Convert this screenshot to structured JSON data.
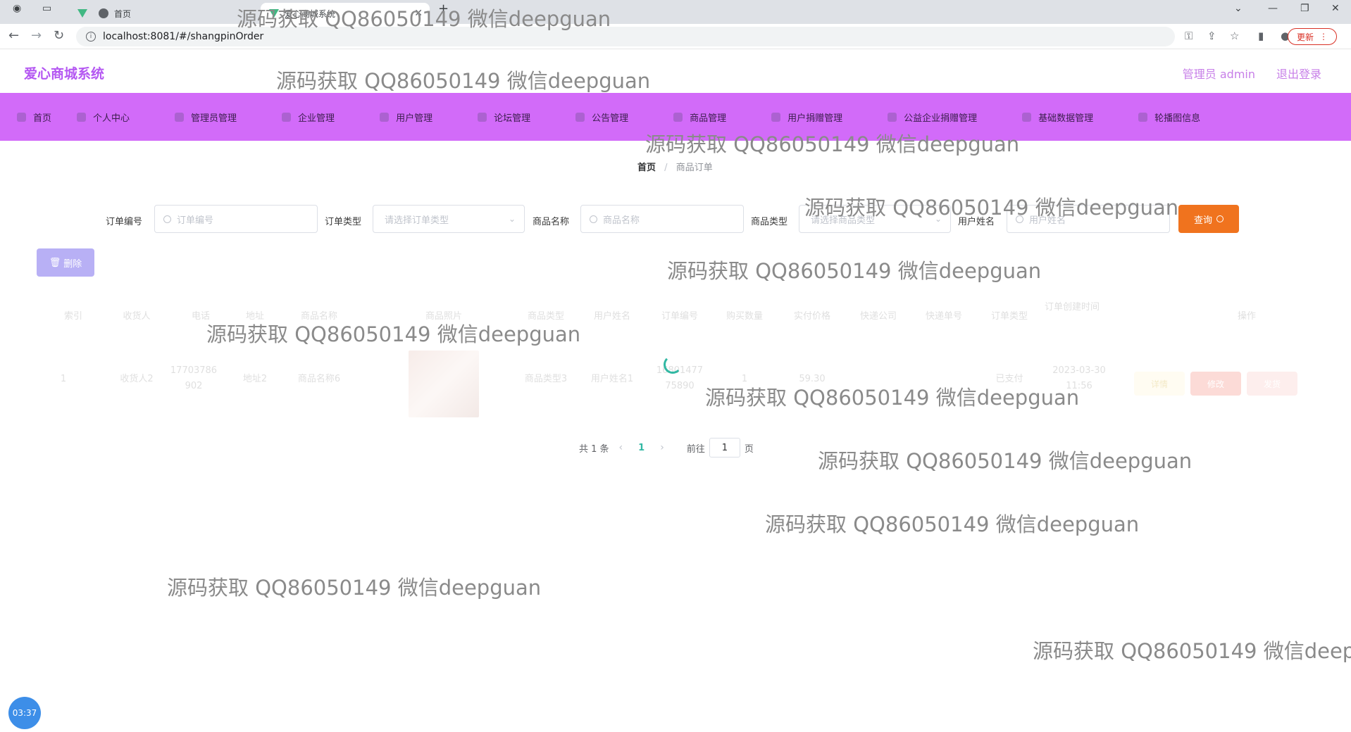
{
  "browser": {
    "tabs": [
      {
        "title": "首页"
      },
      {
        "title": "爱心商城系统"
      }
    ],
    "url": "localhost:8081/#/shangpinOrder",
    "update_label": "更新"
  },
  "header": {
    "app_title": "爱心商城系统",
    "admin_label": "管理员 admin",
    "logout_label": "退出登录"
  },
  "nav": [
    {
      "label": "首页"
    },
    {
      "label": "个人中心"
    },
    {
      "label": "管理员管理"
    },
    {
      "label": "企业管理"
    },
    {
      "label": "用户管理"
    },
    {
      "label": "论坛管理"
    },
    {
      "label": "公告管理"
    },
    {
      "label": "商品管理"
    },
    {
      "label": "用户捐赠管理"
    },
    {
      "label": "公益企业捐赠管理"
    },
    {
      "label": "基础数据管理"
    },
    {
      "label": "轮播图信息"
    }
  ],
  "breadcrumb": {
    "home": "首页",
    "sep": "/",
    "current": "商品订单"
  },
  "search": {
    "order_no": {
      "label": "订单编号",
      "placeholder": "订单编号"
    },
    "order_type": {
      "label": "订单类型",
      "placeholder": "请选择订单类型"
    },
    "product_name": {
      "label": "商品名称",
      "placeholder": "商品名称"
    },
    "product_type": {
      "label": "商品类型",
      "placeholder": "请选择商品类型"
    },
    "user_name": {
      "label": "用户姓名",
      "placeholder": "用户姓名"
    },
    "query_label": "查询"
  },
  "actions": {
    "delete_label": "删除"
  },
  "table": {
    "headers": [
      "索引",
      "收货人",
      "电话",
      "地址",
      "商品名称",
      "商品照片",
      "商品类型",
      "用户姓名",
      "订单编号",
      "购买数量",
      "实付价格",
      "快递公司",
      "快递单号",
      "订单类型",
      "订单创建时间",
      "操作"
    ],
    "rows": [
      {
        "index": "1",
        "receiver": "收货人2",
        "phone": "17703786902",
        "address": "地址2",
        "product_name": "商品名称6",
        "product_type": "商品类型3",
        "user_name": "用户姓名1",
        "order_no": "1680147775890",
        "quantity": "1",
        "price": "59.30",
        "express": "",
        "express_no": "",
        "order_type": "已支付",
        "created": "2023-03-30 11:56"
      }
    ],
    "op_labels": [
      "详情",
      "修改",
      "发货"
    ]
  },
  "pager": {
    "total_label": "共 1 条",
    "current_page": "1",
    "goto_label": "前往",
    "goto_value": "1",
    "page_suffix": "页"
  },
  "timer": "03:37",
  "watermark_text": "源码获取 QQ86050149 微信deepguan",
  "colors": {
    "nav_bg": "#d26bf9",
    "brand": "#b457f2",
    "query_btn": "#f0731e",
    "delete_btn": "#b8b0f5",
    "accent": "#31b8a3"
  }
}
